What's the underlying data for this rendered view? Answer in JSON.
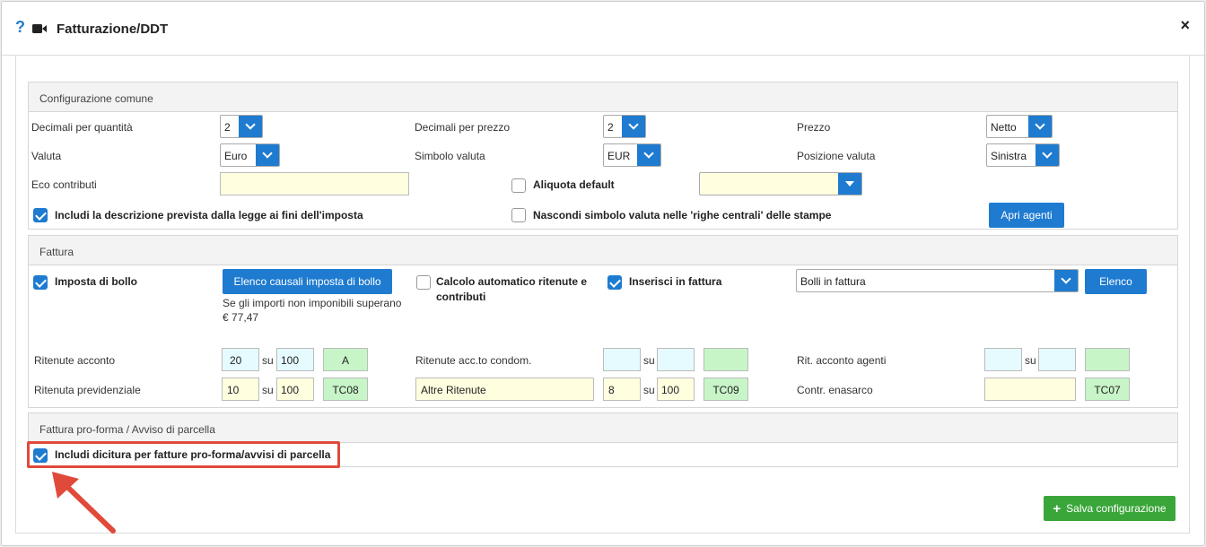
{
  "header": {
    "title": "Fatturazione/DDT",
    "help_glyph": "?",
    "close_glyph": "×"
  },
  "config_comune": {
    "heading": "Configurazione comune",
    "decimali_quantita_label": "Decimali per quantità",
    "decimali_quantita_value": "2",
    "decimali_prezzo_label": "Decimali per prezzo",
    "decimali_prezzo_value": "2",
    "prezzo_label": "Prezzo",
    "prezzo_value": "Netto",
    "valuta_label": "Valuta",
    "valuta_value": "Euro",
    "simbolo_valuta_label": "Simbolo valuta",
    "simbolo_valuta_value": "EUR",
    "posizione_valuta_label": "Posizione valuta",
    "posizione_valuta_value": "Sinistra",
    "eco_contributi_label": "Eco contributi",
    "eco_contributi_value": "",
    "aliquota_default_label": "Aliquota default",
    "aliquota_default_value": "",
    "includi_descrizione_label": "Includi la descrizione prevista dalla legge ai fini dell'imposta",
    "nascondi_simbolo_label": "Nascondi simbolo valuta nelle 'righe centrali' delle stampe",
    "apri_agenti_label": "Apri agenti"
  },
  "fattura": {
    "heading": "Fattura",
    "imposta_bollo_label": "Imposta di bollo",
    "elenco_causali_label": "Elenco causali imposta di bollo",
    "soglia_text_1": "Se gli importi non imponibili superano",
    "soglia_text_2": "€ 77,47",
    "calcolo_auto_label_1": "Calcolo automatico ritenute e",
    "calcolo_auto_label_2": "contributi",
    "inserisci_fattura_label": "Inserisci in fattura",
    "bolli_select_value": "Bolli in fattura",
    "elenco_label": "Elenco",
    "su": "su",
    "ritenute_acconto": {
      "label": "Ritenute acconto",
      "perc": "20",
      "base": "100",
      "code": "A"
    },
    "ritenute_condom": {
      "label": "Ritenute acc.to condom.",
      "perc": "",
      "base": "",
      "code": ""
    },
    "rit_agenti": {
      "label": "Rit. acconto agenti",
      "perc": "",
      "base": "",
      "code": ""
    },
    "ritenuta_previdenziale": {
      "label": "Ritenuta previdenziale",
      "perc": "10",
      "base": "100",
      "code": "TC08"
    },
    "altre_ritenute": {
      "label": "Altre Ritenute",
      "perc": "8",
      "base": "100",
      "code": "TC09"
    },
    "enasarco": {
      "label": "Contr. enasarco",
      "value": "",
      "code": "TC07"
    }
  },
  "proforma": {
    "heading": "Fattura pro-forma / Avviso di parcella",
    "includi_dicitura_label": "Includi dicitura per fatture pro-forma/avvisi di parcella"
  },
  "footer": {
    "salva_label": "Salva configurazione",
    "salva_icon_glyph": "+"
  },
  "colors": {
    "primary": "#1e7bd0",
    "success": "#3aa63a",
    "highlight": "#e04a3a",
    "input_yellow": "#ffffe0",
    "input_cyan": "#e6fbff",
    "input_green": "#c8f5c8"
  }
}
